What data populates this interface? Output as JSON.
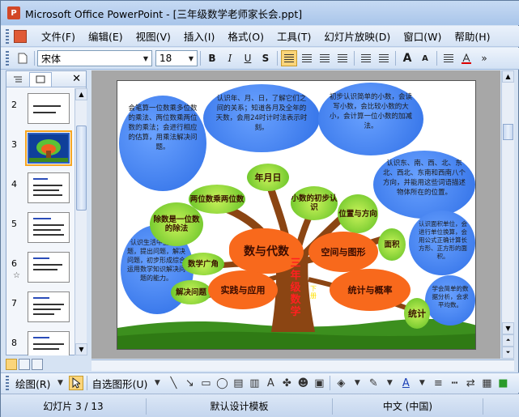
{
  "window": {
    "title": "Microsoft Office PowerPoint - [三年级数学老师家长会.ppt]"
  },
  "menu": [
    "文件(F)",
    "编辑(E)",
    "视图(V)",
    "插入(I)",
    "格式(O)",
    "工具(T)",
    "幻灯片放映(D)",
    "窗口(W)",
    "帮助(H)"
  ],
  "toolbar": {
    "font": "宋体",
    "size": "18",
    "bold": "B",
    "italic": "I",
    "underline": "U",
    "shadow": "S",
    "grow": "A",
    "shrink": "A"
  },
  "slides": [
    {
      "num": "2",
      "selected": false
    },
    {
      "num": "3",
      "selected": true
    },
    {
      "num": "4",
      "selected": false
    },
    {
      "num": "5",
      "selected": false
    },
    {
      "num": "6",
      "selected": false
    },
    {
      "num": "7",
      "selected": false
    },
    {
      "num": "8",
      "selected": false
    }
  ],
  "slide": {
    "clouds": [
      {
        "text": "会笔算一位数乘多位数的乘法、两位数乘两位数的乘法；会进行相应的估算，用乘法解决问题。",
        "color": "#3f86ff"
      },
      {
        "text": "认识年、月、日，了解它们之间的关系；知道各月及全年的天数，会用24时计时法表示时刻。",
        "color": "#3f86ff"
      },
      {
        "text": "初步认识简单的小数，会读写小数，会比较小数的大小，会计算一位小数的加减法。",
        "color": "#3f86ff"
      },
      {
        "text": "认识东、南、西、北、东北、西北、东南和西南八个方向，并能用这些词语描述物体所在的位置。",
        "color": "#3f86ff"
      },
      {
        "text": "认识面积单位，会进行单位换算，会用公式正确计算长方形、正方形的面积。",
        "color": "#3f86ff"
      },
      {
        "text": "认识生活中复式问题，提出问题，解决问题，初步形成综合运用数学知识解决问题的能力。",
        "color": "#3f86ff"
      },
      {
        "text": "学会简单的数据分析，会求平均数。",
        "color": "#3f86ff"
      }
    ],
    "leaves": [
      "两位数乘两位数",
      "年月日",
      "小数的初步认识",
      "位置与方向",
      "除数是一位数的除法",
      "面积",
      "数学广角",
      "解决问题",
      "统计"
    ],
    "branches": [
      "数与代数",
      "空间与图形",
      "实践与应用",
      "统计与概率"
    ],
    "trunk": "三年级数学",
    "trunk_small": "下册"
  },
  "draw": {
    "draw_label": "绘图(R)",
    "autoshapes": "自选图形(U)"
  },
  "status": {
    "slide": "幻灯片 3 / 13",
    "design": "默认设计模板",
    "lang": "中文 (中国)"
  }
}
